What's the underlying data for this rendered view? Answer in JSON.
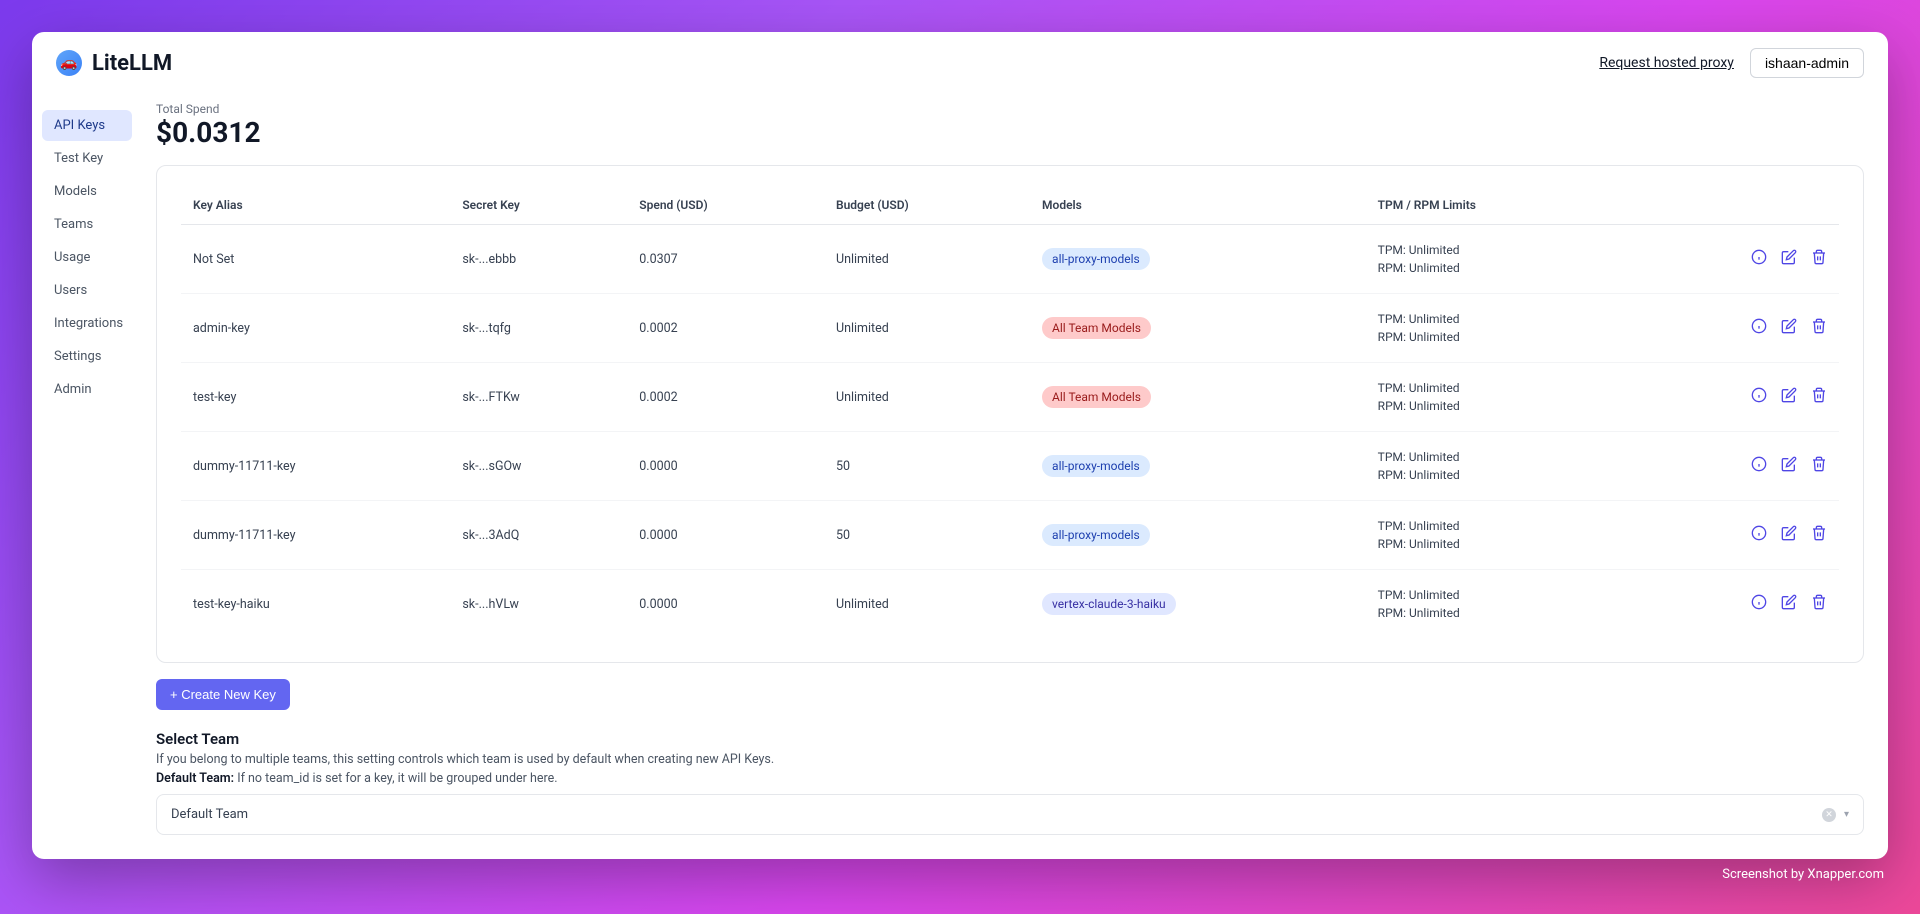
{
  "header": {
    "brand": "LiteLLM",
    "request_link": "Request hosted proxy",
    "user": "ishaan-admin"
  },
  "sidebar": {
    "items": [
      {
        "label": "API Keys",
        "active": true
      },
      {
        "label": "Test Key",
        "active": false
      },
      {
        "label": "Models",
        "active": false
      },
      {
        "label": "Teams",
        "active": false
      },
      {
        "label": "Usage",
        "active": false
      },
      {
        "label": "Users",
        "active": false
      },
      {
        "label": "Integrations",
        "active": false
      },
      {
        "label": "Settings",
        "active": false
      },
      {
        "label": "Admin",
        "active": false
      }
    ]
  },
  "spend": {
    "label": "Total Spend",
    "value": "$0.0312"
  },
  "table": {
    "headers": {
      "alias": "Key Alias",
      "secret": "Secret Key",
      "spend": "Spend (USD)",
      "budget": "Budget (USD)",
      "models": "Models",
      "limits": "TPM / RPM Limits"
    },
    "rows": [
      {
        "alias": "Not Set",
        "secret": "sk-...ebbb",
        "spend": "0.0307",
        "budget": "Unlimited",
        "model": "all-proxy-models",
        "model_style": "blue",
        "tpm": "TPM: Unlimited",
        "rpm": "RPM: Unlimited"
      },
      {
        "alias": "admin-key",
        "secret": "sk-...tqfg",
        "spend": "0.0002",
        "budget": "Unlimited",
        "model": "All Team Models",
        "model_style": "red",
        "tpm": "TPM: Unlimited",
        "rpm": "RPM: Unlimited"
      },
      {
        "alias": "test-key",
        "secret": "sk-...FTKw",
        "spend": "0.0002",
        "budget": "Unlimited",
        "model": "All Team Models",
        "model_style": "red",
        "tpm": "TPM: Unlimited",
        "rpm": "RPM: Unlimited"
      },
      {
        "alias": "dummy-11711-key",
        "secret": "sk-...sGOw",
        "spend": "0.0000",
        "budget": "50",
        "model": "all-proxy-models",
        "model_style": "blue",
        "tpm": "TPM: Unlimited",
        "rpm": "RPM: Unlimited"
      },
      {
        "alias": "dummy-11711-key",
        "secret": "sk-...3AdQ",
        "spend": "0.0000",
        "budget": "50",
        "model": "all-proxy-models",
        "model_style": "blue",
        "tpm": "TPM: Unlimited",
        "rpm": "RPM: Unlimited"
      },
      {
        "alias": "test-key-haiku",
        "secret": "sk-...hVLw",
        "spend": "0.0000",
        "budget": "Unlimited",
        "model": "vertex-claude-3-haiku",
        "model_style": "indigo",
        "tpm": "TPM: Unlimited",
        "rpm": "RPM: Unlimited"
      }
    ]
  },
  "create_button": "+ Create New Key",
  "team_section": {
    "title": "Select Team",
    "desc": "If you belong to multiple teams, this setting controls which team is used by default when creating new API Keys.",
    "default_label": "Default Team:",
    "default_desc": "If no team_id is set for a key, it will be grouped under here.",
    "selected": "Default Team"
  },
  "watermark": "Screenshot by Xnapper.com"
}
